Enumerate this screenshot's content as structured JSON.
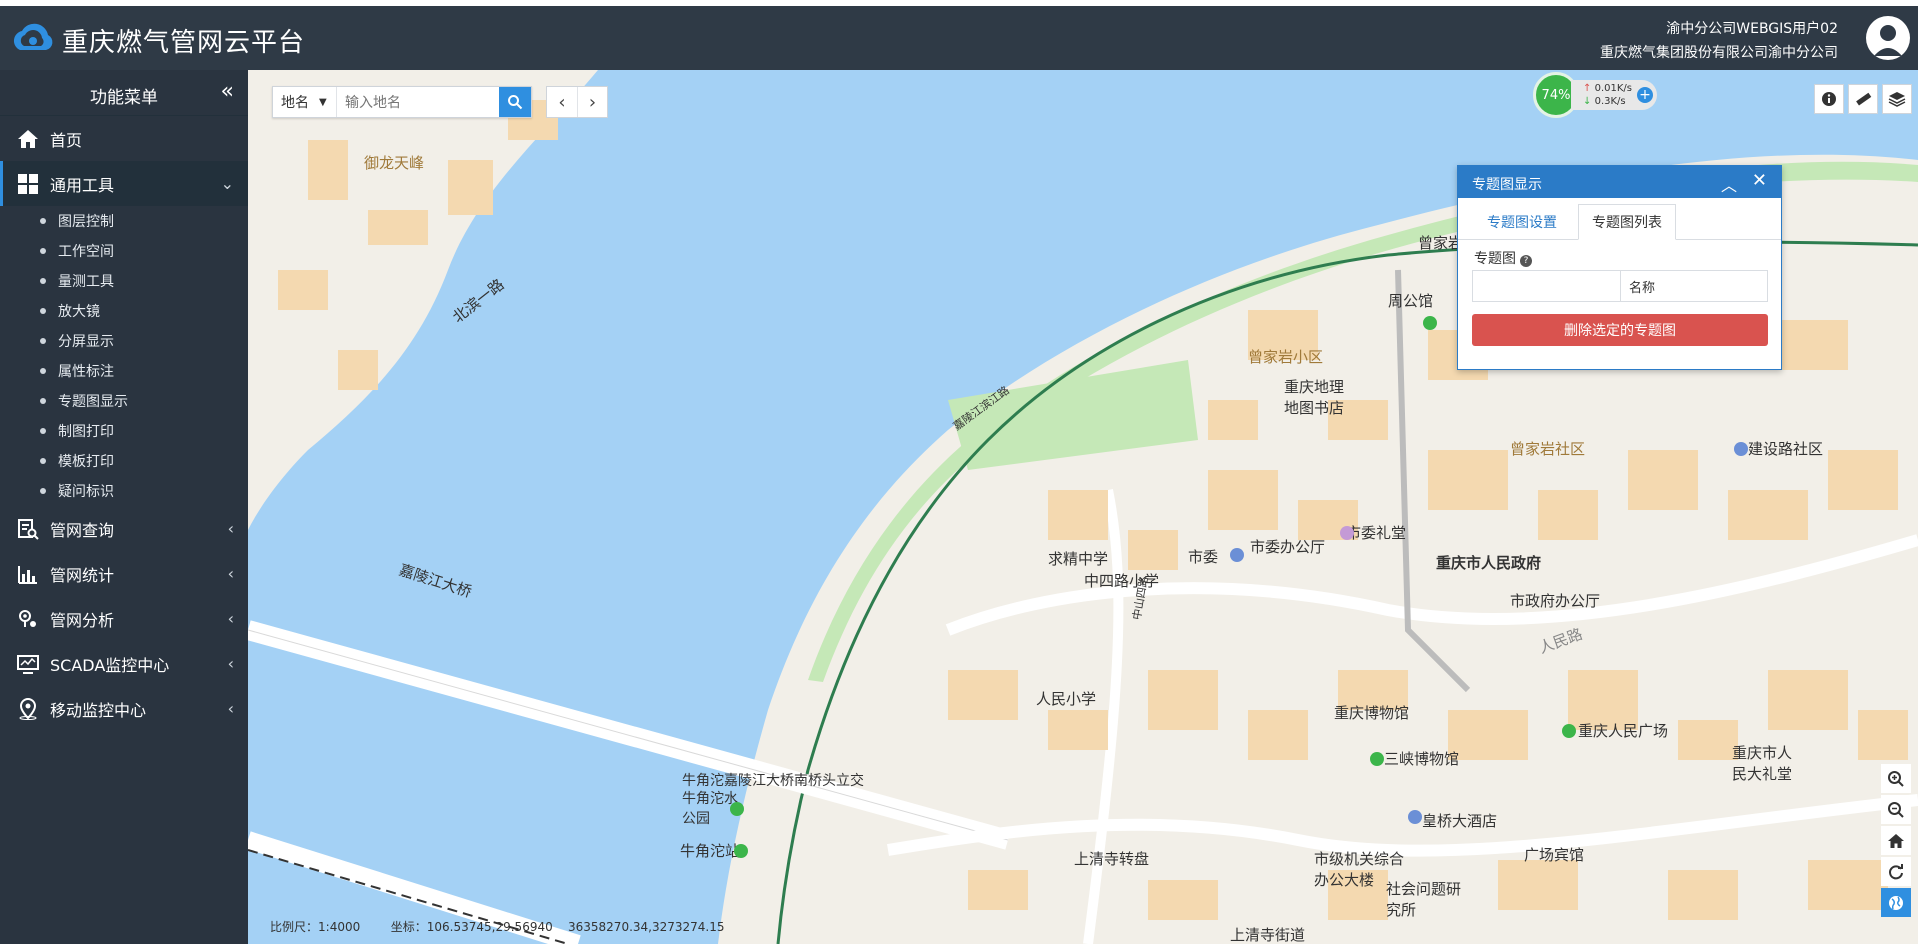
{
  "header": {
    "app_title": "重庆燃气管网云平台",
    "user_name": "渝中分公司WEBGIS用户02",
    "company": "重庆燃气集团股份有限公司渝中分公司"
  },
  "sidebar": {
    "title": "功能菜单",
    "collapse_symbol": "«",
    "items": [
      {
        "label": "首页",
        "icon": "home-icon"
      },
      {
        "label": "通用工具",
        "icon": "grid-icon",
        "expanded": true,
        "children": [
          "图层控制",
          "工作空间",
          "量测工具",
          "放大镜",
          "分屏显示",
          "属性标注",
          "专题图显示",
          "制图打印",
          "模板打印",
          "疑问标识"
        ]
      },
      {
        "label": "管网查询",
        "icon": "query-icon"
      },
      {
        "label": "管网统计",
        "icon": "chart-icon"
      },
      {
        "label": "管网分析",
        "icon": "analysis-icon"
      },
      {
        "label": "SCADA监控中心",
        "icon": "monitor-icon"
      },
      {
        "label": "移动监控中心",
        "icon": "location-icon"
      }
    ]
  },
  "search": {
    "type_label": "地名",
    "placeholder": "输入地名"
  },
  "network": {
    "percent": "74%",
    "up": "0.01K/s",
    "down": "0.3K/s"
  },
  "panel": {
    "title": "专题图显示",
    "tab_settings": "专题图设置",
    "tab_list": "专题图列表",
    "field_label": "专题图",
    "column_name": "名称",
    "delete_label": "删除选定的专题图"
  },
  "status": {
    "scale_label": "比例尺：",
    "scale_value": "1:4000",
    "coord_label": "坐标：",
    "coord_value": "106.53745,29.56940",
    "projected": "36358270.34,3273274.15"
  },
  "map_labels": [
    "御龙天峰",
    "嘉陵江大桥",
    "北滨一路",
    "曾家岩",
    "周公馆",
    "曾家岩小区",
    "重庆地理地图书店",
    "求精中学",
    "中四路小学",
    "市委",
    "市委办公厅",
    "市委礼堂",
    "重庆市人民政府",
    "市政府办公厅",
    "人民小学",
    "重庆博物馆",
    "三峡博物馆",
    "牛角沱嘉陵江大桥南桥头立交",
    "牛角沱水公园",
    "牛角沱站",
    "上清寺转盘",
    "市级机关综合办公大楼",
    "社会问题研究所",
    "上清寺街道",
    "皇桥大酒店",
    "广场宾馆",
    "重庆人民广场",
    "重庆市人民大礼堂",
    "曾家岩社区",
    "建设路社区",
    "嘉陵江滨江路",
    "中山四路",
    "人民路",
    "曾家岩小区"
  ],
  "colors": {
    "header_bg": "#2f3a46",
    "sidebar_bg": "#2a3440",
    "accent": "#2f8fe0",
    "danger": "#d9534f",
    "river": "#a4d1f5",
    "building": "#f4d9b0",
    "park": "#c5e8b7"
  }
}
